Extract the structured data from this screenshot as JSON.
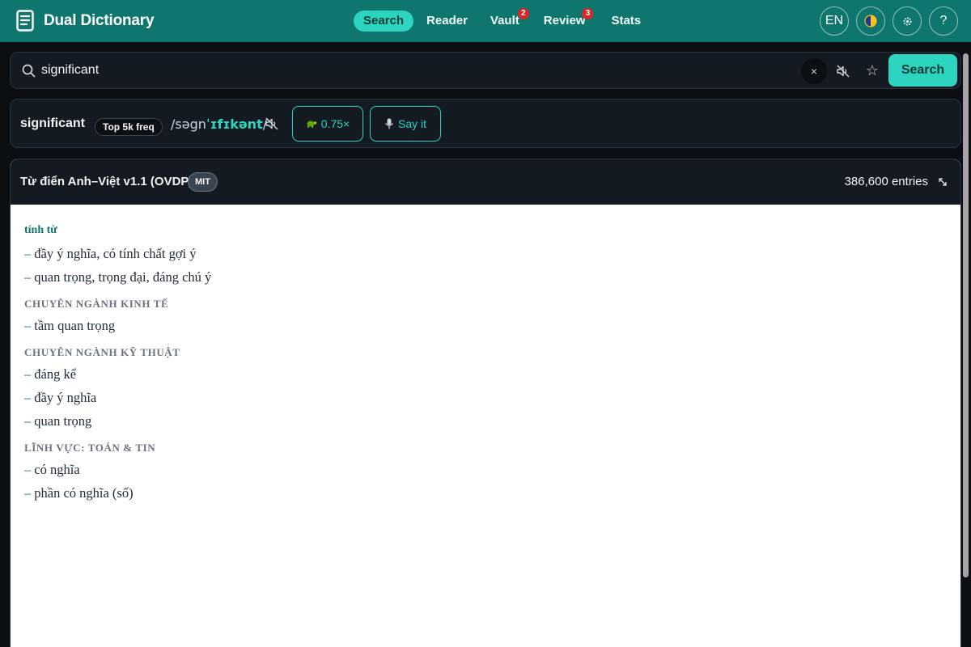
{
  "app": {
    "title": "Dual Dictionary"
  },
  "nav": {
    "items": [
      {
        "label": "Search",
        "active": true,
        "badge": ""
      },
      {
        "label": "Reader",
        "active": false,
        "badge": ""
      },
      {
        "label": "Vault",
        "active": false,
        "badge": "2"
      },
      {
        "label": "Review",
        "active": false,
        "badge": "3"
      },
      {
        "label": "Stats",
        "active": false,
        "badge": ""
      }
    ]
  },
  "top_actions": {
    "language": "EN",
    "theme_icon": "half-moon-icon",
    "settings_icon": "gear-icon",
    "help_label": "?"
  },
  "search": {
    "value": "significant",
    "placeholder": "",
    "clear_label": "×",
    "star_label": "☆",
    "button_label": "Search"
  },
  "word": {
    "headword": "significant",
    "frequency_badge": "Top 5k freq",
    "ipa_prefix": "/səgn",
    "ipa_stress": "ˈɪfɪkənt",
    "ipa_suffix": "/",
    "speed_label": "0.75×",
    "say_label": "Say it"
  },
  "dictionary": {
    "name": "Từ điển Anh–Việt v1.1 (OVDP)",
    "license": "MIT",
    "entry_count": "386,600 entries",
    "part_of_speech": "tính từ",
    "dash": "–",
    "senses": [
      "đầy ý nghĩa, có tính chất gợi ý",
      "quan trọng, trọng đại, đáng chú ý"
    ],
    "domains": [
      {
        "label": "CHUYÊN NGÀNH KINH TẾ",
        "senses": [
          "tầm quan trọng"
        ]
      },
      {
        "label": "CHUYÊN NGÀNH KỸ THUẬT",
        "senses": [
          "đáng kể",
          "đầy ý nghĩa",
          "quan trọng"
        ]
      },
      {
        "label": "LĨNH VỰC: TOÁN & TIN",
        "senses": [
          "có nghĩa",
          "phần có nghĩa (số)"
        ]
      }
    ]
  },
  "colors": {
    "topbar": "#0f766e",
    "accent": "#2dd4bf",
    "badge": "#dc2626",
    "panel": "#141a22"
  }
}
